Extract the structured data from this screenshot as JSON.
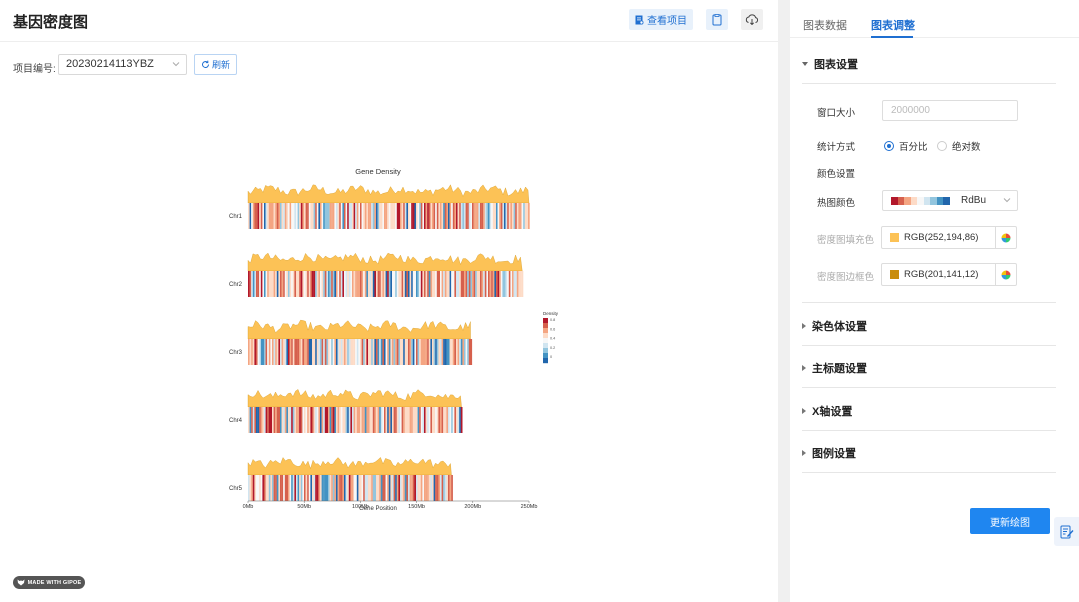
{
  "header": {
    "title": "基因密度图",
    "view_project_label": "查看项目"
  },
  "project": {
    "label": "项目编号:",
    "value": "20230214113YBZ",
    "refresh_label": "刷新"
  },
  "watermark": "MADE WITH GIPOE",
  "chart_data": {
    "type": "heatmap",
    "title": "Gene Density",
    "xlabel": "Gene Position",
    "x_ticks": [
      "0Mb",
      "50Mb",
      "100Mb",
      "150Mb",
      "200Mb",
      "250Mb"
    ],
    "xlim": [
      0,
      250
    ],
    "chromosomes": [
      {
        "name": "Chr1",
        "length_mb": 250
      },
      {
        "name": "Chr2",
        "length_mb": 244
      },
      {
        "name": "Chr3",
        "length_mb": 198
      },
      {
        "name": "Chr4",
        "length_mb": 190
      },
      {
        "name": "Chr5",
        "length_mb": 181
      }
    ],
    "legend": {
      "title": "Density",
      "ticks": [
        "0.8",
        "0.6",
        "0.4",
        "0.2",
        "0"
      ],
      "placement": "right"
    },
    "area_fill": "#FCC256",
    "area_stroke": "#C98D0C"
  },
  "panel": {
    "tabs": [
      {
        "label": "图表数据",
        "active": false
      },
      {
        "label": "图表调整",
        "active": true
      }
    ],
    "chart_settings": {
      "title": "图表设置",
      "window_size_label": "窗口大小",
      "window_size_placeholder": "2000000",
      "stat_method_label": "统计方式",
      "stat_options": [
        "百分比",
        "绝对数"
      ],
      "stat_selected": "百分比",
      "color_settings_label": "颜色设置",
      "heatmap_color_label": "热图颜色",
      "heatmap_palette": "RdBu",
      "palette_colors": [
        "#B2182B",
        "#D6604D",
        "#F4A582",
        "#FDDBC7",
        "#F7F7F7",
        "#D1E5F0",
        "#92C5DE",
        "#4393C3",
        "#2166AC"
      ],
      "density_fill_label": "密度图填充色",
      "density_fill_value": "RGB(252,194,86)",
      "density_fill_color": "#FCC256",
      "density_border_label": "密度图边框色",
      "density_border_value": "RGB(201,141,12)",
      "density_border_color": "#C98D0C"
    },
    "sections": [
      "染色体设置",
      "主标题设置",
      "X轴设置",
      "图例设置"
    ],
    "update_label": "更新绘图"
  }
}
